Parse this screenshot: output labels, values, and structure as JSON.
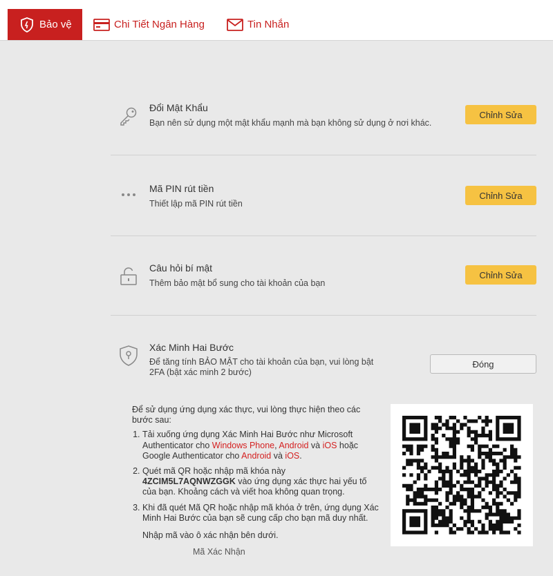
{
  "tabs": [
    {
      "label": "Bảo vệ",
      "icon": "shield-icon",
      "active": true
    },
    {
      "label": "Chi Tiết Ngân Hàng",
      "icon": "bank-card-icon",
      "active": false
    },
    {
      "label": "Tin Nhắn",
      "icon": "envelope-icon",
      "active": false
    }
  ],
  "colors": {
    "brand_red": "#c8201f",
    "edit_button": "#f6c242",
    "background": "#e9e9e9"
  },
  "security": {
    "password": {
      "title": "Đổi Mật Khẩu",
      "desc": "Bạn nên sử dụng một mật khẩu mạnh mà bạn không sử dụng ở nơi khác.",
      "button": "Chỉnh Sửa",
      "icon": "key-icon"
    },
    "pin": {
      "title": "Mã PIN rút tiền",
      "desc": "Thiết lập mã PIN rút tiền",
      "button": "Chỉnh Sửa",
      "icon": "dots-icon"
    },
    "question": {
      "title": "Câu hỏi bí mật",
      "desc": "Thêm bảo mật bổ sung cho tài khoản của bạn",
      "button": "Chỉnh Sửa",
      "icon": "lock-icon"
    },
    "twofa": {
      "title": "Xác Minh Hai Bước",
      "desc_line1": "Để tăng tính BẢO MẬT cho tài khoản của bạn, vui lòng bật",
      "desc_line2": "2FA (bật xác minh 2 bước)",
      "button": "Đóng",
      "icon": "shield-keyhole-icon"
    }
  },
  "instructions": {
    "intro": "Để sử dụng ứng dụng xác thực, vui lòng thực hiện theo các bước sau:",
    "step1_a": "Tải xuống ứng dụng Xác Minh Hai Bước như Microsoft Authenticator cho ",
    "step1_wp": "Windows Phone",
    "step1_comma": ", ",
    "step1_android": "Android",
    "step1_and": " và ",
    "step1_ios": "iOS",
    "step1_b": " hoặc Google Authenticator cho ",
    "step1_android2": "Android",
    "step1_and2": " và ",
    "step1_ios2": "iOS",
    "step1_end": ".",
    "step2_a": "Quét mã QR hoặc nhập mã khóa này",
    "step2_code": "4ZCIM5L7AQNWZGGK",
    "step2_b": " vào ứng dụng xác thực hai yếu tố của bạn. Khoảng cách và viết hoa không quan trọng.",
    "step3": "Khi đã quét Mã QR hoặc nhập mã khóa ở trên, ứng dụng Xác Minh Hai Bước của bạn sẽ cung cấp cho bạn mã duy nhất.",
    "note": "Nhập mã vào ô xác nhận bên dưới.",
    "cut_label": "Mã Xác Nhận"
  }
}
